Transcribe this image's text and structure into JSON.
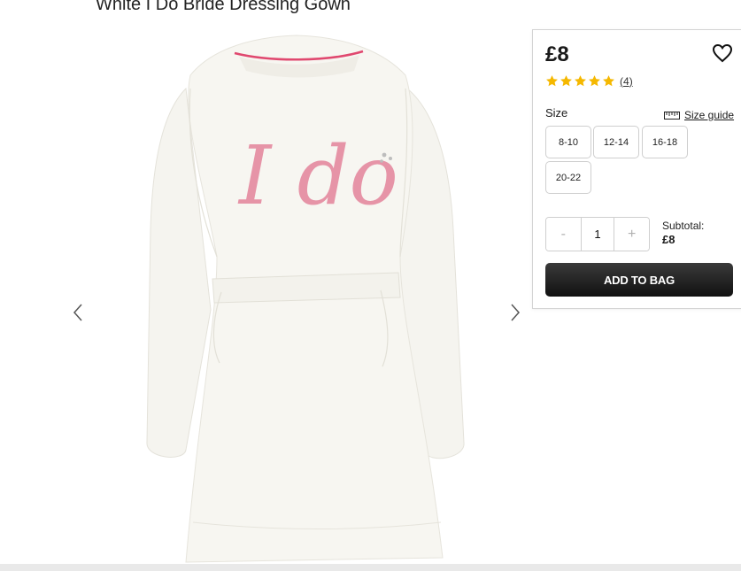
{
  "product": {
    "title": "White I Do Bride Dressing Gown",
    "image_alt": "White I Do Bride Dressing Gown back view",
    "embroidery_text": "I do"
  },
  "gallery": {
    "prev_icon": "chevron-left-icon",
    "next_icon": "chevron-right-icon"
  },
  "panel": {
    "price": "£8",
    "wishlist_icon": "heart-outline-icon",
    "rating": {
      "stars": 5,
      "max": 5,
      "count_label": "4"
    },
    "size_label": "Size",
    "size_guide_label": "Size guide",
    "size_guide_icon": "ruler-icon",
    "sizes": [
      "8-10",
      "12-14",
      "16-18",
      "20-22"
    ],
    "quantity": {
      "minus": "-",
      "value": "1",
      "plus": "+"
    },
    "subtotal_label": "Subtotal:",
    "subtotal_value": "£8",
    "add_to_bag_label": "ADD TO BAG"
  },
  "colors": {
    "star": "#f5b800",
    "gown": "#f7f6f1",
    "embroidery": "#e58aa0",
    "trim": "#e0486f",
    "button_dark": "#1a1a1a"
  }
}
